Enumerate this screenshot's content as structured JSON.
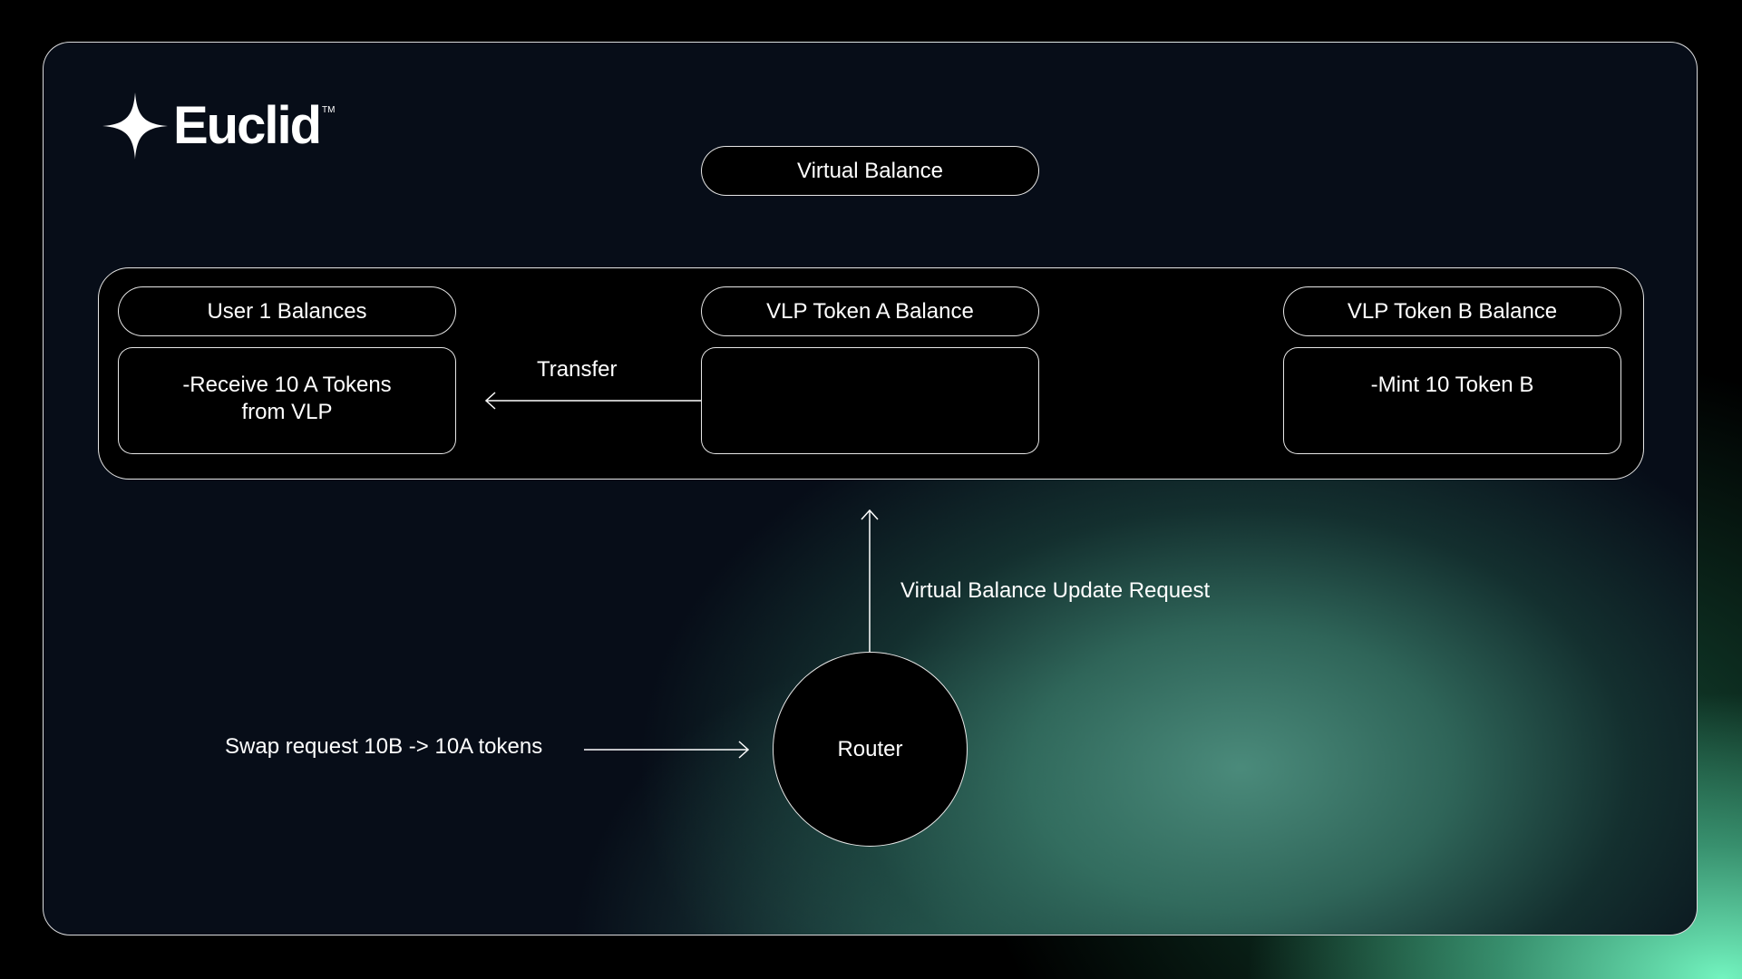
{
  "brand": {
    "name": "Euclid",
    "trademark": "TM",
    "icon": "four-point-star-icon"
  },
  "diagram": {
    "title": "Virtual Balance",
    "columns": [
      {
        "header": "User 1 Balances",
        "body_line1": "-Receive 10 A Tokens",
        "body_line2": "from VLP"
      },
      {
        "header": "VLP Token A Balance",
        "body_line1": "",
        "body_line2": ""
      },
      {
        "header": "VLP Token B Balance",
        "body_line1": "-Mint 10 Token B",
        "body_line2": ""
      }
    ],
    "transfer_label": "Transfer",
    "update_request_label": "Virtual Balance Update Request",
    "swap_request_label": "Swap request 10B -> 10A tokens",
    "router_label": "Router"
  },
  "colors": {
    "background": "#000000",
    "panel": "#070d18",
    "accent_green": "#78ffc8",
    "stroke": "#ffffff"
  }
}
